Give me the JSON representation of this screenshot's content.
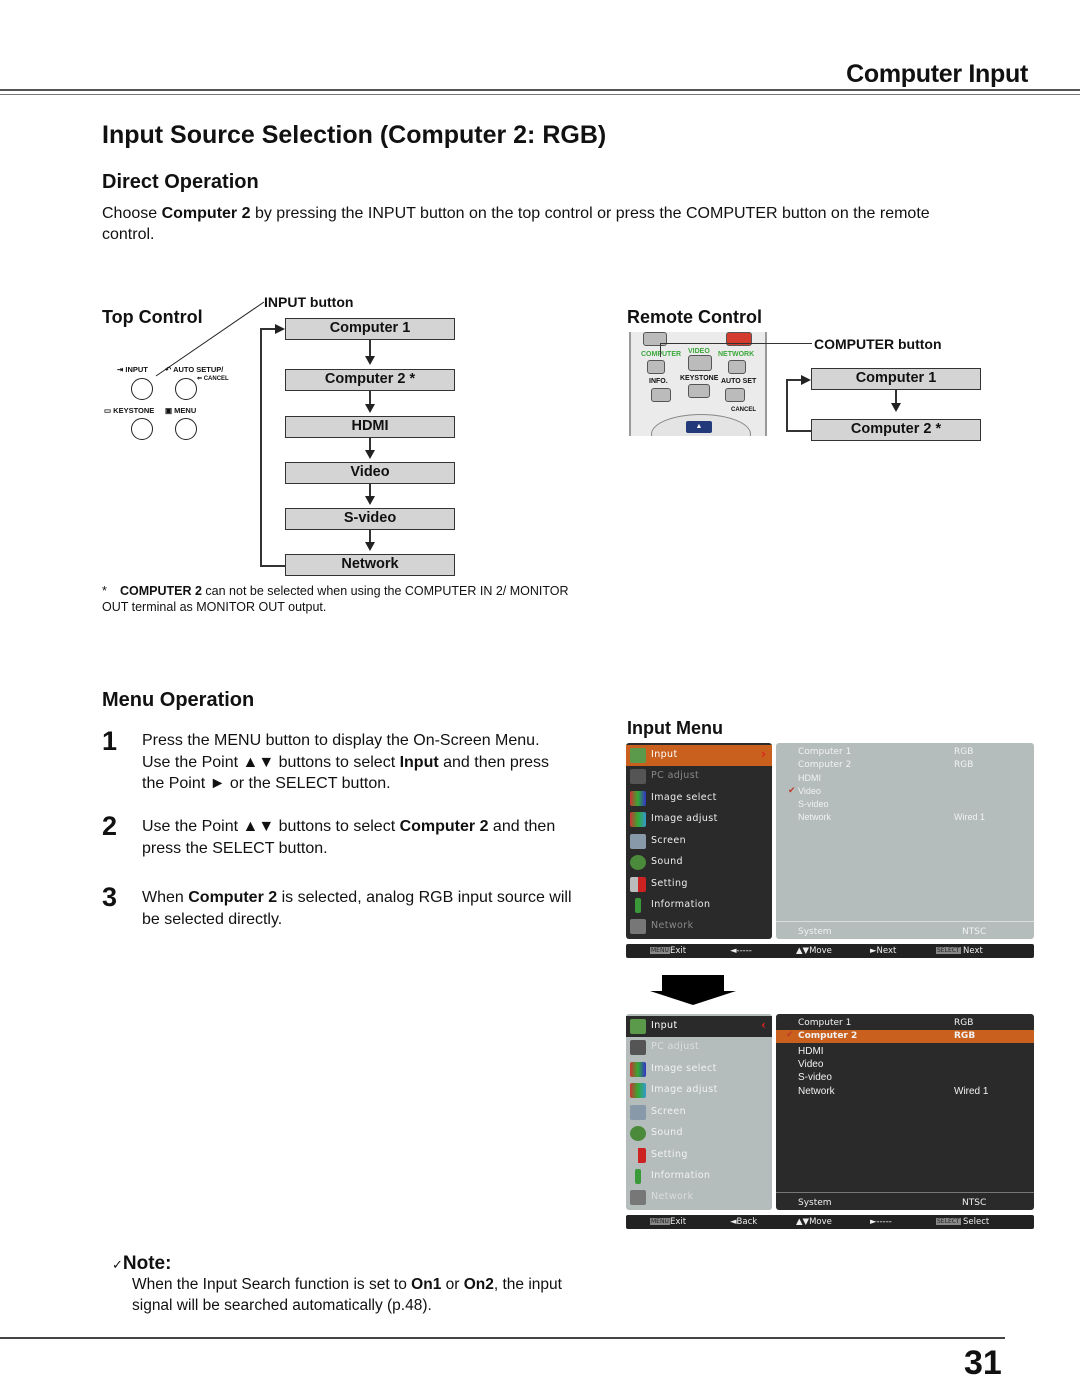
{
  "header": {
    "section_title": "Computer Input"
  },
  "page_title": "Input Source Selection (Computer 2: RGB)",
  "direct_operation": {
    "title": "Direct Operation",
    "intro_pre": "Choose ",
    "intro_bold": "Computer 2",
    "intro_post": " by pressing the INPUT button on the top control or press the COMPUTER button on the remote control."
  },
  "top_control": {
    "title": "Top Control",
    "callout": "INPUT button",
    "buttons": [
      {
        "label": "INPUT",
        "icon": "input-icon"
      },
      {
        "label": "AUTO SETUP/",
        "sub": "CANCEL",
        "icon": "auto-setup-icon"
      },
      {
        "label": "KEYSTONE",
        "icon": "keystone-icon"
      },
      {
        "label": "MENU",
        "icon": "menu-icon"
      }
    ],
    "flow": [
      "Computer 1",
      "Computer 2 *",
      "HDMI",
      "Video",
      "S-video",
      "Network"
    ]
  },
  "remote_control": {
    "title": "Remote Control",
    "callout": "COMPUTER button",
    "remote_labels": [
      "COMPUTER",
      "VIDEO",
      "NETWORK",
      "INFO.",
      "KEYSTONE",
      "AUTO SET",
      "CANCEL"
    ],
    "flow": [
      "Computer 1",
      "Computer 2 *"
    ]
  },
  "footnote": {
    "mark": "*",
    "bold": "COMPUTER 2",
    "text": " can not be selected when using the COMPUTER IN 2/ MONITOR OUT terminal as MONITOR OUT output."
  },
  "menu_operation": {
    "title": "Menu Operation",
    "steps": [
      {
        "num": "1",
        "parts": [
          "Press the MENU button to display the On-Screen Menu. Use the Point ▲▼ buttons to select ",
          "Input",
          " and then press the Point ► or the SELECT button."
        ]
      },
      {
        "num": "2",
        "parts": [
          "Use the Point ▲▼ buttons to select ",
          "Computer 2",
          " and then press the SELECT button."
        ]
      },
      {
        "num": "3",
        "parts": [
          "When ",
          "Computer 2",
          " is selected, analog RGB input source will be selected directly."
        ]
      }
    ]
  },
  "input_menu": {
    "title": "Input Menu",
    "left_items": [
      {
        "label": "Input",
        "icon": "input-icon"
      },
      {
        "label": "PC adjust",
        "icon": "pc-adjust-icon"
      },
      {
        "label": "Image select",
        "icon": "image-select-icon"
      },
      {
        "label": "Image adjust",
        "icon": "image-adjust-icon"
      },
      {
        "label": "Screen",
        "icon": "screen-icon"
      },
      {
        "label": "Sound",
        "icon": "sound-icon"
      },
      {
        "label": "Setting",
        "icon": "setting-icon"
      },
      {
        "label": "Information",
        "icon": "information-icon"
      },
      {
        "label": "Network",
        "icon": "network-icon"
      }
    ],
    "right_rows": [
      {
        "name": "Computer 1",
        "value": "RGB"
      },
      {
        "name": "Computer 2",
        "value": "RGB"
      },
      {
        "name": "HDMI",
        "value": ""
      },
      {
        "name": "Video",
        "value": ""
      },
      {
        "name": "S-video",
        "value": ""
      },
      {
        "name": "Network",
        "value": "Wired 1"
      }
    ],
    "system": {
      "label": "System",
      "value": "NTSC"
    },
    "screen1": {
      "checked_row": "Video",
      "bar": [
        "MENU",
        "Exit",
        "◄-----",
        "▲▼Move",
        "►Next",
        "SELECT",
        "Next"
      ]
    },
    "screen2": {
      "checked_row": "Computer 2",
      "bar": [
        "MENU",
        "Exit",
        "◄Back",
        "▲▼Move",
        "►-----",
        "SELECT",
        "Select"
      ]
    }
  },
  "note": {
    "title": "Note:",
    "parts": [
      "When the Input Search function is set to ",
      "On1",
      " or ",
      "On2",
      ", the input signal will be searched automatically (p.48)."
    ]
  },
  "page_number": "31"
}
